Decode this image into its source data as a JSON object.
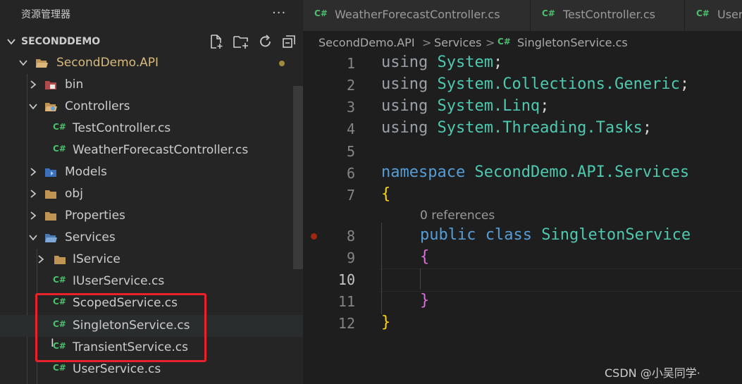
{
  "explorer": {
    "title": "资源管理器",
    "more": "···",
    "section_title": "SECONDDEMO",
    "tree": [
      {
        "label": "SecondDemo.API",
        "kind": "folder",
        "open": true
      },
      {
        "label": "bin",
        "kind": "folder",
        "open": false
      },
      {
        "label": "Controllers",
        "kind": "folder",
        "open": true
      },
      {
        "label": "TestController.cs",
        "kind": "csharp"
      },
      {
        "label": "WeatherForecastController.cs",
        "kind": "csharp"
      },
      {
        "label": "Models",
        "kind": "folder",
        "open": false
      },
      {
        "label": "obj",
        "kind": "folder",
        "open": false
      },
      {
        "label": "Properties",
        "kind": "folder",
        "open": false
      },
      {
        "label": "Services",
        "kind": "folder",
        "open": true
      },
      {
        "label": "IService",
        "kind": "folder",
        "open": false
      },
      {
        "label": "IUserService.cs",
        "kind": "csharp"
      },
      {
        "label": "ScopedService.cs",
        "kind": "csharp"
      },
      {
        "label": "SingletonService.cs",
        "kind": "csharp"
      },
      {
        "label": "TransientService.cs",
        "kind": "csharp"
      },
      {
        "label": "UserService.cs",
        "kind": "csharp"
      }
    ]
  },
  "cs_badge": "C#",
  "tabs": [
    {
      "label": "WeatherForecastController.cs"
    },
    {
      "label": "TestController.cs"
    },
    {
      "label": "User"
    }
  ],
  "breadcrumb": {
    "items": [
      "SecondDemo.API",
      "Services",
      "SingletonService.cs"
    ],
    "separator": ">"
  },
  "editor": {
    "line_numbers": [
      "1",
      "2",
      "3",
      "4",
      "5",
      "6",
      "7",
      "8",
      "9",
      "10",
      "11",
      "12"
    ],
    "active_line": "10",
    "codelens": "0 references",
    "code": {
      "l1": {
        "kw": "using",
        "ns": "System",
        "end": ";"
      },
      "l2": {
        "kw": "using",
        "ns": "System.Collections.Generic",
        "end": ";"
      },
      "l3": {
        "kw": "using",
        "ns": "System.Linq",
        "end": ";"
      },
      "l4": {
        "kw": "using",
        "ns": "System.Threading.Tasks",
        "end": ";"
      },
      "l6": {
        "kw": "namespace",
        "ns": "SecondDemo.API.Services"
      },
      "l7": {
        "brace": "{"
      },
      "l8": {
        "kw1": "public",
        "kw2": "class",
        "name": "SingletonService"
      },
      "l9": {
        "brace": "{"
      },
      "l11": {
        "brace": "}"
      },
      "l12": {
        "brace": "}"
      }
    }
  },
  "watermark": "CSDN @小吴同学·",
  "colors": {
    "highlight_box": "#e8212b",
    "csharp_badge": "#4cbf6e",
    "folder_open_label": "#d7ba7d",
    "keyword": "#569cd6",
    "type": "#4ec9b0",
    "breakpoint": "#a1260d"
  }
}
